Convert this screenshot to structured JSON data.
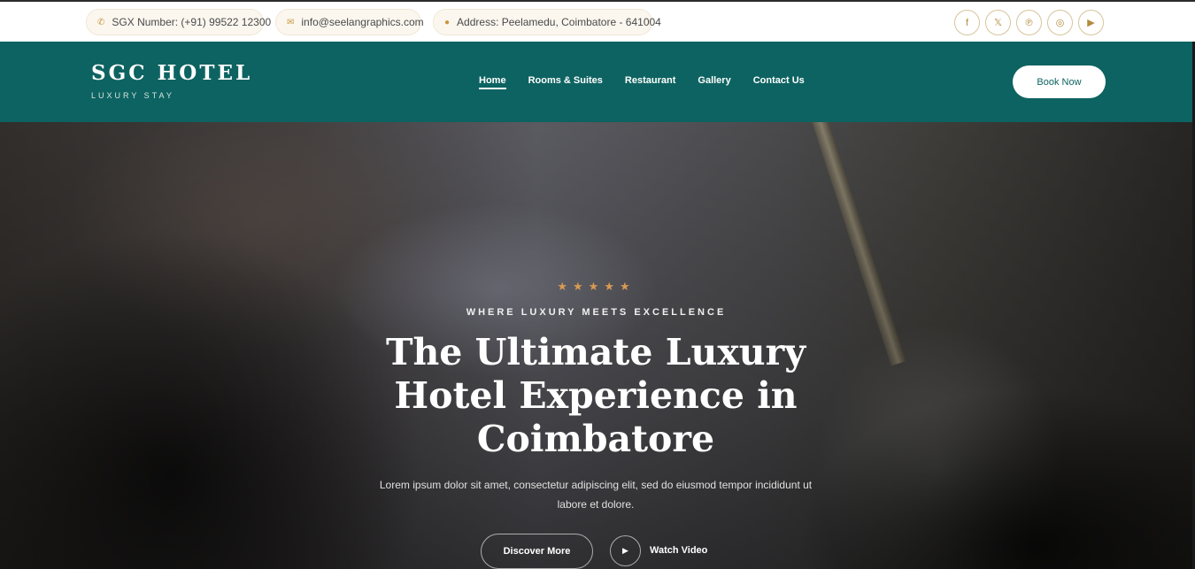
{
  "topbar": {
    "phone": {
      "icon": "phone-icon",
      "text": "SGX Number: (+91) 99522 12300"
    },
    "email": {
      "icon": "mail-icon",
      "text": "info@seelangraphics.com"
    },
    "address": {
      "icon": "location-pin-icon",
      "text": "Address: Peelamedu, Coimbatore - 641004"
    },
    "socials": [
      {
        "name": "facebook-icon",
        "glyph": "f"
      },
      {
        "name": "x-twitter-icon",
        "glyph": "𝕏"
      },
      {
        "name": "pinterest-icon",
        "glyph": "℗"
      },
      {
        "name": "instagram-icon",
        "glyph": "◎"
      },
      {
        "name": "youtube-icon",
        "glyph": "▶"
      }
    ]
  },
  "navbar": {
    "brand_name": "SGC HOTEL",
    "brand_tagline": "LUXURY STAY",
    "links": [
      {
        "label": "Home",
        "active": true
      },
      {
        "label": "Rooms & Suites",
        "active": false
      },
      {
        "label": "Restaurant",
        "active": false
      },
      {
        "label": "Gallery",
        "active": false
      },
      {
        "label": "Contact Us",
        "active": false
      }
    ],
    "cta": "Book Now"
  },
  "hero": {
    "stars": "★★★★★",
    "kicker": "WHERE LUXURY MEETS EXCELLENCE",
    "headline": "The Ultimate Luxury Hotel Experience in Coimbatore",
    "description": "Lorem ipsum dolor sit amet, consectetur adipiscing elit, sed do eiusmod tempor incididunt ut labore et dolore.",
    "primary_button": "Discover More",
    "video_button_icon": "▶",
    "video_label": "Watch Video"
  },
  "colors": {
    "teal": "#0d6361",
    "gold": "#d99a52",
    "white": "#ffffff"
  }
}
